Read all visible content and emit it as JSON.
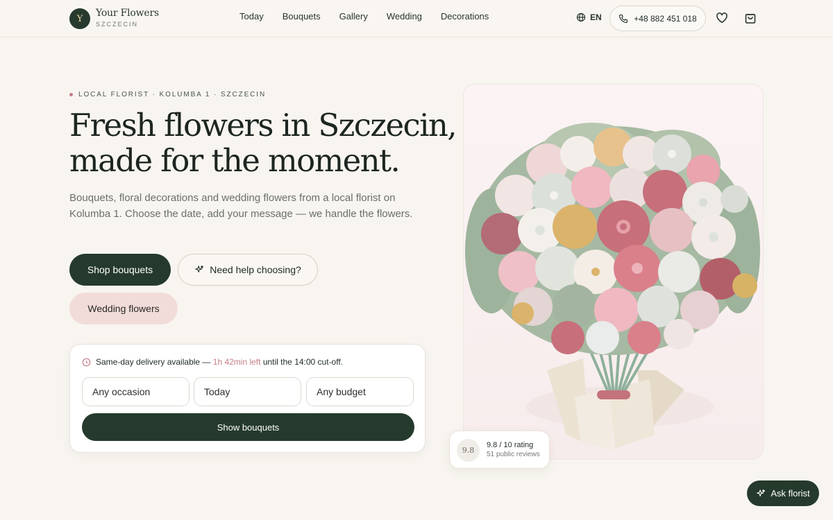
{
  "brand": {
    "initial": "Y",
    "name": "Your Flowers",
    "city": "SZCZECIN"
  },
  "nav": [
    {
      "label": "Today"
    },
    {
      "label": "Bouquets"
    },
    {
      "label": "Gallery"
    },
    {
      "label": "Wedding"
    },
    {
      "label": "Decorations"
    }
  ],
  "header": {
    "language": "EN",
    "phone": "+48 882 451 018",
    "icons": {
      "language": "globe-icon",
      "phone": "phone-icon",
      "wishlist": "heart-icon",
      "cart": "bag-icon"
    }
  },
  "hero": {
    "kicker": "LOCAL FLORIST · KOLUMBA 1 · SZCZECIN",
    "headline_line1": "Fresh flowers in Szczecin,",
    "headline_line2": "made for the moment.",
    "lede": "Bouquets, floral decorations and wedding flowers from a local florist on Kolumba 1. Choose the date, add your message — we handle the flowers.",
    "primary_cta": "Shop bouquets",
    "secondary_cta": "Need help choosing?",
    "tertiary_cta": "Wedding flowers"
  },
  "delivery": {
    "lead": "Same-day delivery available —",
    "time_left": "1h 42min left",
    "tail": "until the 14:00 cut-off.",
    "occasion_value": "Any occasion",
    "date_value": "Today",
    "budget_value": "Any budget",
    "submit_label": "Show bouquets"
  },
  "rating": {
    "score": "9.8",
    "title": "9.8 / 10 rating",
    "subtitle": "51 public reviews"
  },
  "assistant": {
    "label": "Ask florist"
  },
  "colors": {
    "accent_dark": "#253a2c",
    "accent_pink": "#c47c86",
    "soft_pink": "#f2dcd9",
    "background": "#f8f5f0"
  }
}
